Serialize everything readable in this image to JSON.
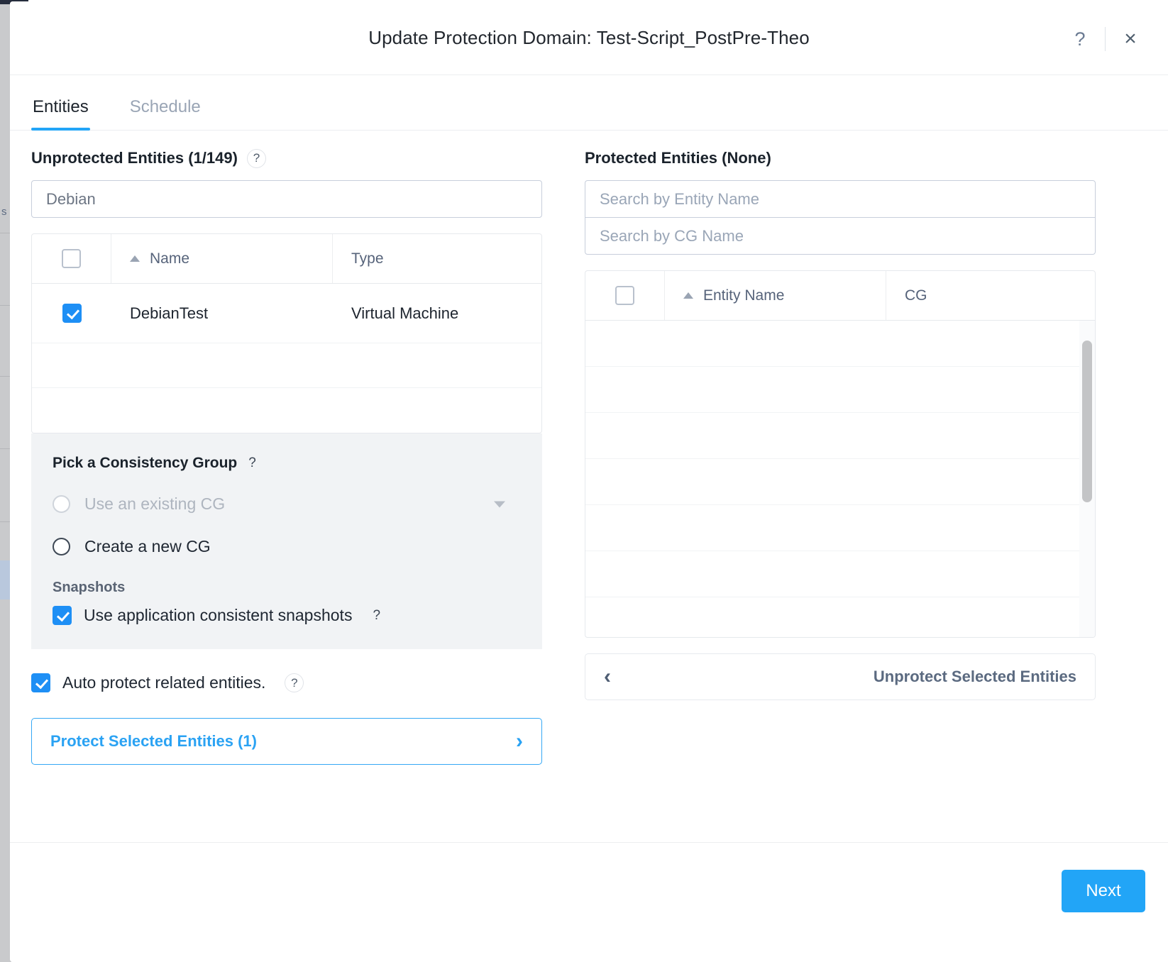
{
  "modal": {
    "title": "Update Protection Domain: Test-Script_PostPre-Theo",
    "help_icon": "?",
    "close_icon": "×",
    "tabs": [
      {
        "label": "Entities",
        "active": true
      },
      {
        "label": "Schedule",
        "active": false
      }
    ]
  },
  "left_panel": {
    "heading": "Unprotected Entities (1/149)",
    "heading_help": "?",
    "search_value": "Debian",
    "table": {
      "columns": [
        "",
        "Name",
        "Type"
      ],
      "sort_column": "Name",
      "sort_direction": "asc",
      "header_checkbox_checked": false,
      "rows": [
        {
          "checked": true,
          "name": "DebianTest",
          "type": "Virtual Machine"
        },
        {
          "checked": false,
          "name": "",
          "type": ""
        },
        {
          "checked": false,
          "name": "",
          "type": ""
        }
      ]
    },
    "cg_panel": {
      "title": "Pick a Consistency Group",
      "title_help": "?",
      "options": [
        {
          "label": "Use an existing CG",
          "selected": false,
          "disabled": true,
          "has_dropdown": true
        },
        {
          "label": "Create a new CG",
          "selected": false,
          "disabled": false,
          "has_dropdown": false
        }
      ],
      "snapshots_label": "Snapshots",
      "snapshot_option": {
        "label": "Use application consistent snapshots",
        "checked": true,
        "help": "?"
      }
    },
    "auto_protect": {
      "label": "Auto protect related entities.",
      "checked": true,
      "help": "?"
    },
    "protect_button": {
      "label": "Protect Selected Entities (1)",
      "chevron": "›"
    }
  },
  "right_panel": {
    "heading": "Protected Entities (None)",
    "entity_search_placeholder": "Search by Entity Name",
    "entity_search_value": "",
    "cg_search_placeholder": "Search by CG Name",
    "cg_search_value": "",
    "table": {
      "columns": [
        "",
        "Entity Name",
        "CG"
      ],
      "sort_column": "Entity Name",
      "sort_direction": "asc",
      "header_checkbox_checked": false,
      "rows": [
        {
          "entity_name": "",
          "cg": ""
        },
        {
          "entity_name": "",
          "cg": ""
        },
        {
          "entity_name": "",
          "cg": ""
        },
        {
          "entity_name": "",
          "cg": ""
        },
        {
          "entity_name": "",
          "cg": ""
        },
        {
          "entity_name": "",
          "cg": ""
        },
        {
          "entity_name": "",
          "cg": ""
        }
      ]
    },
    "unprotect_button": {
      "label": "Unprotect Selected Entities",
      "chevron": "‹"
    }
  },
  "footer": {
    "next_label": "Next"
  },
  "colors": {
    "accent": "#22a5f7",
    "checkbox_checked": "#1e8ff5",
    "panel_bg": "#f1f3f5",
    "muted_text": "#5b6a80"
  }
}
